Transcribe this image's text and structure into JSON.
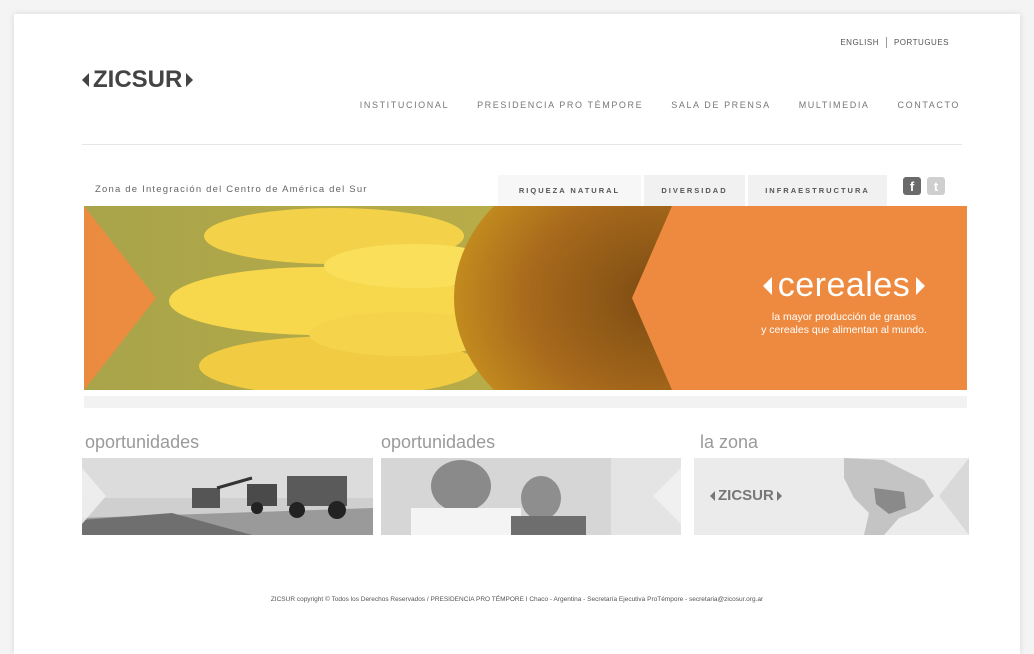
{
  "lang": {
    "english": "ENGLISH",
    "portugues": "PORTUGUES"
  },
  "logo": {
    "text": "ZICSUR"
  },
  "nav": [
    "INSTITUCIONAL",
    "PRESIDENCIA PRO TÉMPORE",
    "SALA DE PRENSA",
    "MULTIMEDIA",
    "CONTACTO"
  ],
  "tagline": "Zona de Integración del Centro de América del Sur",
  "tabs": [
    "RIQUEZA NATURAL",
    "DIVERSIDAD",
    "INFRAESTRUCTURA"
  ],
  "social": {
    "facebook_icon": "f",
    "twitter_icon": "t"
  },
  "banner": {
    "title": "cereales",
    "subtitle_line1": "la mayor producción de granos",
    "subtitle_line2": "y cereales que alimentan al mundo."
  },
  "sections": [
    {
      "label": "oportunidades"
    },
    {
      "label": "oportunidades"
    },
    {
      "label": "la zona",
      "logo": "ZICSUR"
    }
  ],
  "footer": "ZICSUR copyright © Todos los Derechos Reservados / PRESIDENCIA PRO TÉMPORE I Chaco - Argentina - Secretaría Ejecutiva ProTémpore - secretaria@zicosur.org.ar",
  "colors": {
    "accent": "#ee8a3f",
    "text": "#555555",
    "muted": "#9a9a9a"
  }
}
